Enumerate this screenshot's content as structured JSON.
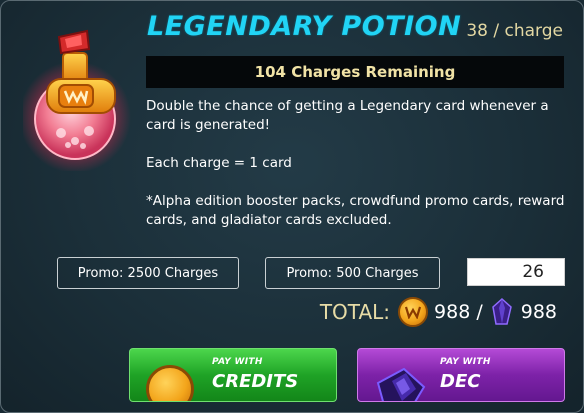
{
  "item": {
    "title": "LEGENDARY POTION",
    "price": "38 / charge",
    "charges_remaining": "104 Charges Remaining"
  },
  "description": {
    "line1": "Double the chance of getting a Legendary card whenever a card is generated!",
    "line2": "Each charge = 1 card",
    "line3": "*Alpha edition booster packs, crowdfund promo cards, reward cards, and gladiator cards excluded."
  },
  "promos": [
    {
      "label": "Promo: 2500 Charges"
    },
    {
      "label": "Promo: 500 Charges"
    }
  ],
  "quantity": {
    "value": "26"
  },
  "total": {
    "label": "TOTAL:",
    "credits_amount": "988 /",
    "dec_amount": "988"
  },
  "pay_credits": {
    "small": "PAY WITH",
    "big": "CREDITS"
  },
  "pay_dec": {
    "small": "PAY WITH",
    "big": "DEC"
  },
  "icons": {
    "potion": "legendary-potion-icon",
    "credits": "credits-coin-icon",
    "dec": "dec-crystal-icon"
  },
  "colors": {
    "title": "#21d4f5",
    "accent_text": "#e7dca6",
    "credits_button": "#1fa326",
    "dec_button": "#7d22a8"
  }
}
